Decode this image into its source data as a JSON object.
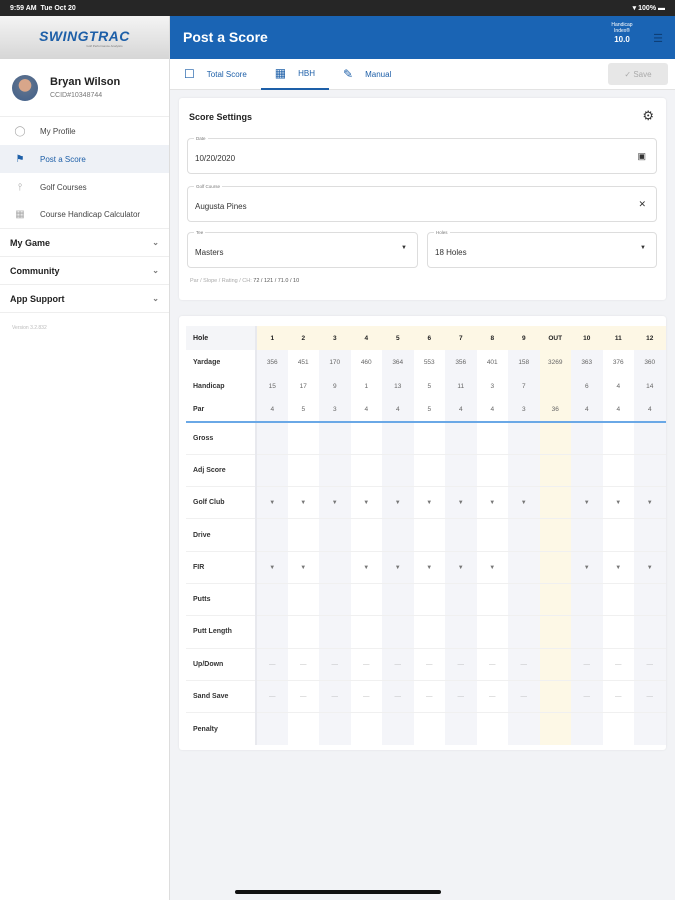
{
  "status": {
    "time": "9:59 AM",
    "date": "Tue Oct 20",
    "battery": "100%"
  },
  "sidebar": {
    "logo": "SWINGTRAC",
    "logo_tagline": "Golf Performance Analytics",
    "user": {
      "name": "Bryan Wilson",
      "id": "CCID#10348744"
    },
    "items": [
      {
        "label": "My Profile",
        "icon": "person-circle-icon"
      },
      {
        "label": "Post a Score",
        "icon": "flag-icon"
      },
      {
        "label": "Golf Courses",
        "icon": "pin-icon"
      },
      {
        "label": "Course Handicap Calculator",
        "icon": "grid-icon"
      }
    ],
    "groups": [
      {
        "label": "My Game"
      },
      {
        "label": "Community"
      },
      {
        "label": "App Support"
      }
    ],
    "version": "Version 3.2.832"
  },
  "header": {
    "title": "Post a Score",
    "handicap_label": "Handicap Index®",
    "handicap_value": "10.0"
  },
  "tabs": [
    {
      "label": "Total Score"
    },
    {
      "label": "HBH"
    },
    {
      "label": "Manual"
    }
  ],
  "save_label": "Save",
  "settings": {
    "title": "Score Settings",
    "date_label": "Date",
    "date": "10/20/2020",
    "course_label": "Golf Course",
    "course": "Augusta Pines",
    "tee_label": "Tee",
    "tee": "Masters",
    "holes_label": "Holes",
    "holes": "18 Holes",
    "info_label": "Par / Slope / Rating / CH:",
    "info_value": "72 / 121 / 71.0 / 10"
  },
  "scorecard": {
    "holes": [
      "1",
      "2",
      "3",
      "4",
      "5",
      "6",
      "7",
      "8",
      "9",
      "OUT",
      "10",
      "11",
      "12"
    ],
    "rows": [
      {
        "label": "Hole"
      },
      {
        "label": "Yardage",
        "values": [
          "356",
          "451",
          "170",
          "460",
          "364",
          "553",
          "356",
          "401",
          "158",
          "3269",
          "363",
          "376",
          "360"
        ]
      },
      {
        "label": "Handicap",
        "values": [
          "15",
          "17",
          "9",
          "1",
          "13",
          "5",
          "11",
          "3",
          "7",
          "",
          "6",
          "4",
          "14"
        ]
      },
      {
        "label": "Par",
        "values": [
          "4",
          "5",
          "3",
          "4",
          "4",
          "5",
          "4",
          "4",
          "3",
          "36",
          "4",
          "4",
          "4"
        ]
      }
    ],
    "entry_rows": [
      "Gross",
      "Adj Score",
      "Golf Club",
      "Drive",
      "FIR",
      "Putts",
      "Putt Length",
      "Up/Down",
      "Sand Save",
      "Penalty"
    ]
  }
}
